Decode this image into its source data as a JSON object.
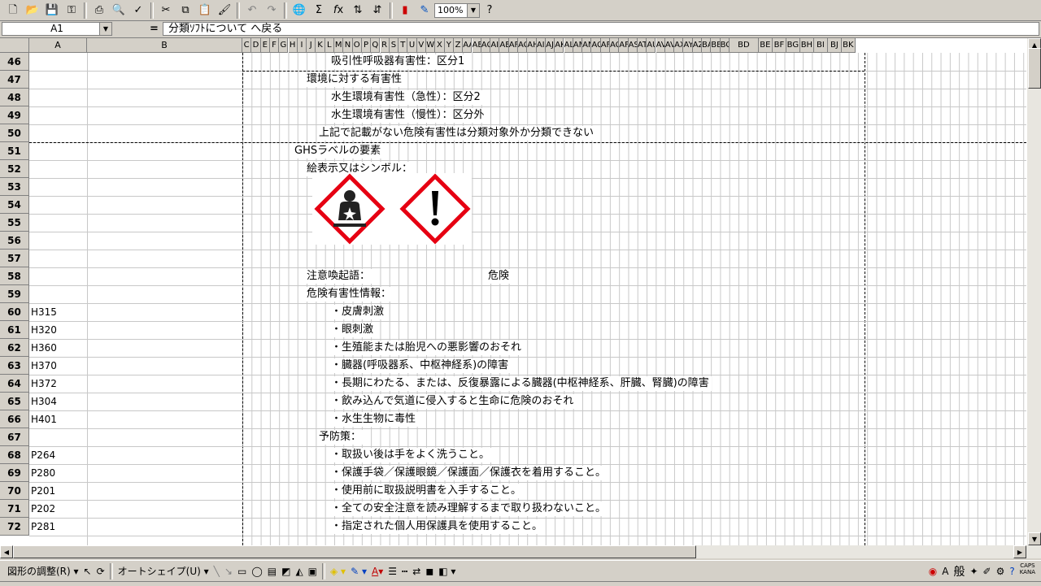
{
  "toolbar": {
    "icons": [
      "new-icon",
      "open-icon",
      "save-icon",
      "permission-icon",
      "print-icon",
      "print-preview-icon",
      "spelling-icon",
      "cut-icon",
      "copy-icon",
      "paste-icon",
      "format-painter-icon",
      "undo-icon",
      "redo-icon",
      "hyperlink-icon",
      "autosum-icon",
      "function-icon",
      "sort-asc-icon",
      "sort-desc-icon",
      "chart-wizard-icon",
      "drawing-icon",
      "help-icon"
    ],
    "zoom": "100%"
  },
  "formula_bar": {
    "name_box": "A1",
    "equals": "=",
    "content": "分類ｿﾌﾄについて へ戻る"
  },
  "columns": {
    "wide": [
      {
        "label": "A"
      },
      {
        "label": "B"
      }
    ],
    "narrow": [
      "C",
      "D",
      "E",
      "F",
      "G",
      "H",
      "I",
      "J",
      "K",
      "L",
      "M",
      "N",
      "O",
      "P",
      "Q",
      "R",
      "S",
      "T",
      "U",
      "V",
      "W",
      "X",
      "Y",
      "Z",
      "AA",
      "AE",
      "AC",
      "AI",
      "AE",
      "AF",
      "AC",
      "AH",
      "AI",
      "AJ",
      "AK",
      "AL",
      "AM",
      "AN",
      "AC",
      "AF",
      "AC",
      "AF",
      "AS",
      "AT",
      "AU",
      "AV",
      "AV",
      "AX",
      "AY",
      "AZ",
      "BA",
      "BB",
      "BC"
    ],
    "tail": [
      "BD",
      "BE",
      "BF",
      "BG",
      "BH",
      "BI",
      "BJ",
      "BK"
    ]
  },
  "rows": [
    {
      "num": "46",
      "code": "",
      "text": "吸引性呼吸器有害性：区分1",
      "indent": 3
    },
    {
      "num": "47",
      "code": "",
      "text": "環境に対する有害性",
      "indent": 1
    },
    {
      "num": "48",
      "code": "",
      "text": "水生環境有害性（急性）：区分2",
      "indent": 3
    },
    {
      "num": "49",
      "code": "",
      "text": "水生環境有害性（慢性）：区分外",
      "indent": 3
    },
    {
      "num": "50",
      "code": "",
      "text": "上記で記載がない危険有害性は分類対象外か分類できない",
      "indent": 2
    },
    {
      "num": "51",
      "code": "",
      "text": "GHSラベルの要素",
      "indent": 0
    },
    {
      "num": "52",
      "code": "",
      "text": "絵表示又はシンボル：",
      "indent": 1
    },
    {
      "num": "53",
      "code": "",
      "text": "",
      "indent": 0
    },
    {
      "num": "54",
      "code": "",
      "text": "",
      "indent": 0
    },
    {
      "num": "55",
      "code": "",
      "text": "",
      "indent": 0
    },
    {
      "num": "56",
      "code": "",
      "text": "",
      "indent": 0
    },
    {
      "num": "57",
      "code": "",
      "text": "",
      "indent": 0
    },
    {
      "num": "58",
      "code": "",
      "text": "注意喚起語：",
      "indent": 1
    },
    {
      "num": "59",
      "code": "",
      "text": "危険有害性情報：",
      "indent": 1
    },
    {
      "num": "60",
      "code": "H315",
      "text": "・皮膚刺激",
      "indent": 3
    },
    {
      "num": "61",
      "code": "H320",
      "text": "・眼刺激",
      "indent": 3
    },
    {
      "num": "62",
      "code": "H360",
      "text": "・生殖能または胎児への悪影響のおそれ",
      "indent": 3
    },
    {
      "num": "63",
      "code": "H370",
      "text": "・臓器(呼吸器系、中枢神経系)の障害",
      "indent": 3
    },
    {
      "num": "64",
      "code": "H372",
      "text": "・長期にわたる、または、反復暴露による臓器(中枢神経系、肝臓、腎臓)の障害",
      "indent": 3
    },
    {
      "num": "65",
      "code": "H304",
      "text": "・飲み込んで気道に侵入すると生命に危険のおそれ",
      "indent": 3
    },
    {
      "num": "66",
      "code": "H401",
      "text": "・水生生物に毒性",
      "indent": 3
    },
    {
      "num": "67",
      "code": "",
      "text": "予防策：",
      "indent": 2
    },
    {
      "num": "68",
      "code": "P264",
      "text": "・取扱い後は手をよく洗うこと。",
      "indent": 3
    },
    {
      "num": "69",
      "code": "P280",
      "text": "・保護手袋／保護眼鏡／保護面／保護衣を着用すること。",
      "indent": 3
    },
    {
      "num": "70",
      "code": "P201",
      "text": "・使用前に取扱説明書を入手すること。",
      "indent": 3
    },
    {
      "num": "71",
      "code": "P202",
      "text": "・全ての安全注意を読み理解するまで取り扱わないこと。",
      "indent": 3
    },
    {
      "num": "72",
      "code": "P281",
      "text": "・指定された個人用保護具を使用すること。",
      "indent": 3
    }
  ],
  "signal_word": "危険",
  "pictograms": [
    "health-hazard-pictogram",
    "exclamation-mark-pictogram"
  ],
  "drawing_toolbar": {
    "draw_label": "図形の調整(R)",
    "autoshape_label": "オートシェイプ(U)",
    "ime_label": "般",
    "caps": "CAPS",
    "kana": "KANA"
  },
  "colors": {
    "chrome": "#d4d0c8",
    "pictogram_red": "#e60012"
  }
}
